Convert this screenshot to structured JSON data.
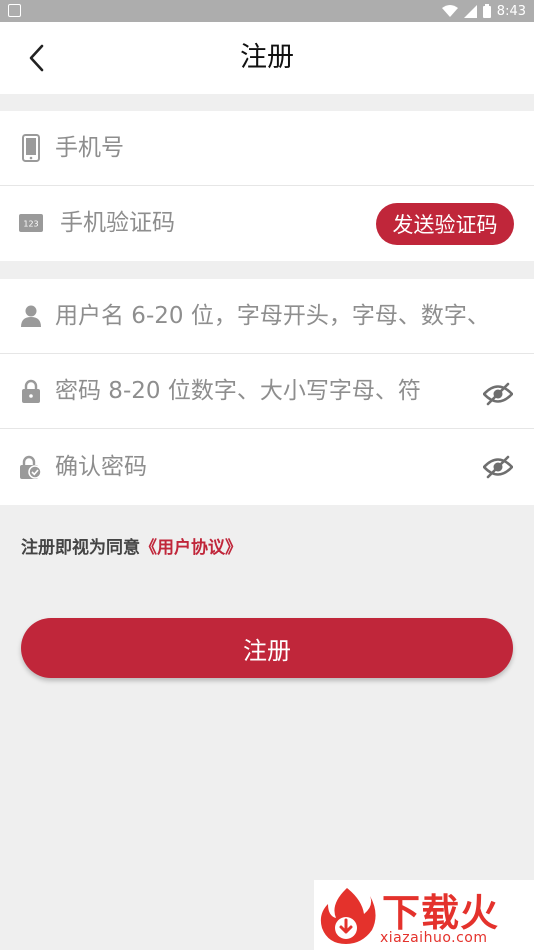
{
  "status_bar": {
    "time": "8:43"
  },
  "nav": {
    "title": "注册"
  },
  "form": {
    "phone": {
      "placeholder": "手机号",
      "value": ""
    },
    "sms_code": {
      "placeholder": "手机验证码",
      "value": "",
      "icon_text": "123"
    },
    "send_code_label": "发送验证码",
    "username": {
      "placeholder": "用户名 6-20 位，字母开头，字母、数字、",
      "value": ""
    },
    "password": {
      "placeholder": "密码 8-20 位数字、大小写字母、符",
      "value": ""
    },
    "confirm_password": {
      "placeholder": "确认密码",
      "value": ""
    }
  },
  "agreement": {
    "prefix": "注册即视为同意",
    "link": "《用户协议》"
  },
  "submit_label": "注册",
  "watermark": {
    "name": "下载火",
    "domain": "xiazaihuo.com"
  },
  "colors": {
    "accent": "#c0263a",
    "background": "#efefef",
    "placeholder": "#8e8e8e"
  },
  "icons": [
    "phone-icon",
    "keypad-icon",
    "user-icon",
    "lock-icon",
    "lock-check-icon",
    "eye-off-icon",
    "back-chevron-icon"
  ]
}
